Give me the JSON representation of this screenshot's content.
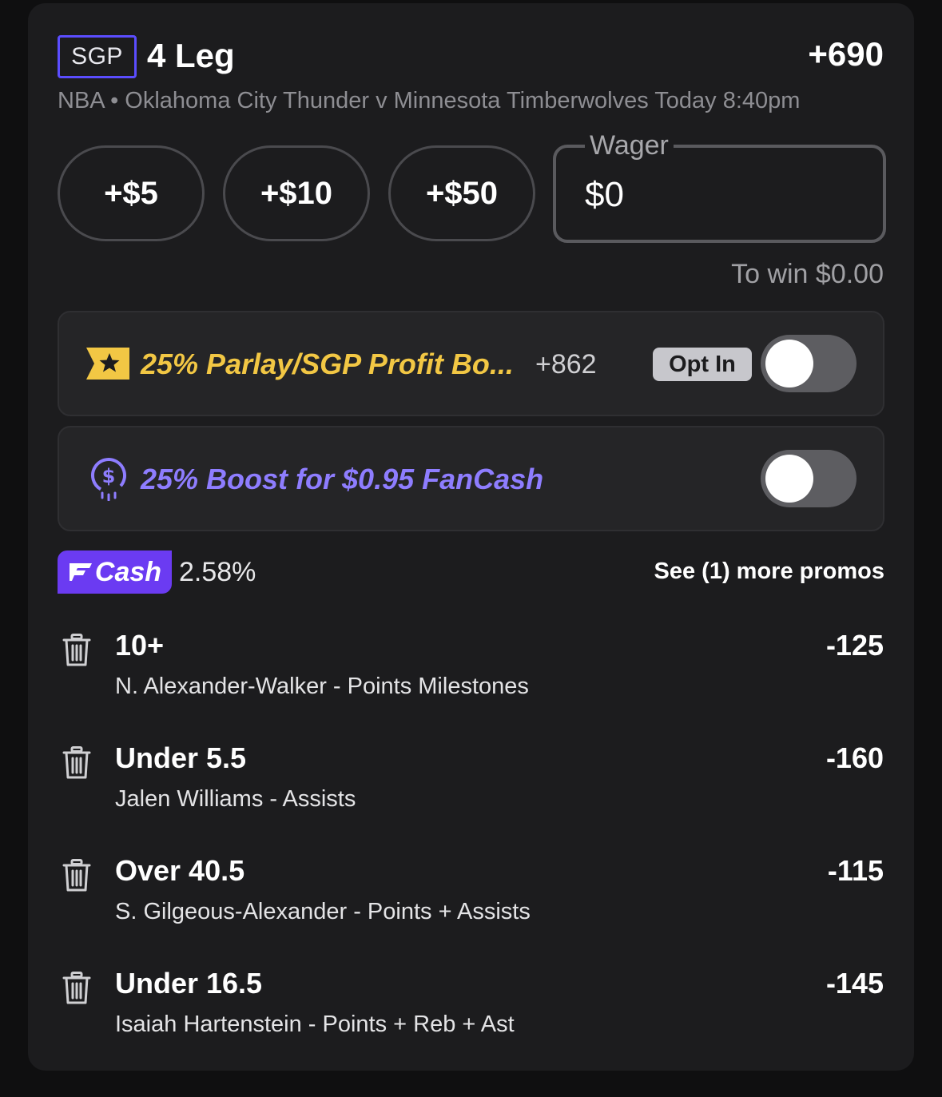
{
  "header": {
    "badge": "SGP",
    "title": "4 Leg",
    "odds": "+690",
    "subtitle": "NBA • Oklahoma City Thunder v Minnesota Timberwolves Today 8:40pm"
  },
  "stake": {
    "chips": [
      "+$5",
      "+$10",
      "+$50"
    ],
    "wager_label": "Wager",
    "wager_value": "$0",
    "to_win": "To win $0.00"
  },
  "promos": {
    "profit_boost": {
      "icon": "ticket-star-icon",
      "text": "25% Parlay/SGP Profit Bo...",
      "odds": "+862",
      "opt_in": "Opt In",
      "enabled": false,
      "color": "#f2c744"
    },
    "fancash_boost": {
      "icon": "dollar-coin-icon",
      "text": "25% Boost for $0.95 FanCash",
      "enabled": false,
      "color": "#8e7dff"
    }
  },
  "fancash": {
    "badge": "Cash",
    "percent": "2.58%",
    "more_promos": "See (1) more promos",
    "color": "#6b3bf2"
  },
  "legs": [
    {
      "selection": "10+",
      "description": "N. Alexander-Walker - Points Milestones",
      "odds": "-125"
    },
    {
      "selection": "Under 5.5",
      "description": "Jalen Williams - Assists",
      "odds": "-160"
    },
    {
      "selection": "Over 40.5",
      "description": "S. Gilgeous-Alexander - Points + Assists",
      "odds": "-115"
    },
    {
      "selection": "Under 16.5",
      "description": "Isaiah Hartenstein - Points + Reb + Ast",
      "odds": "-145"
    }
  ]
}
